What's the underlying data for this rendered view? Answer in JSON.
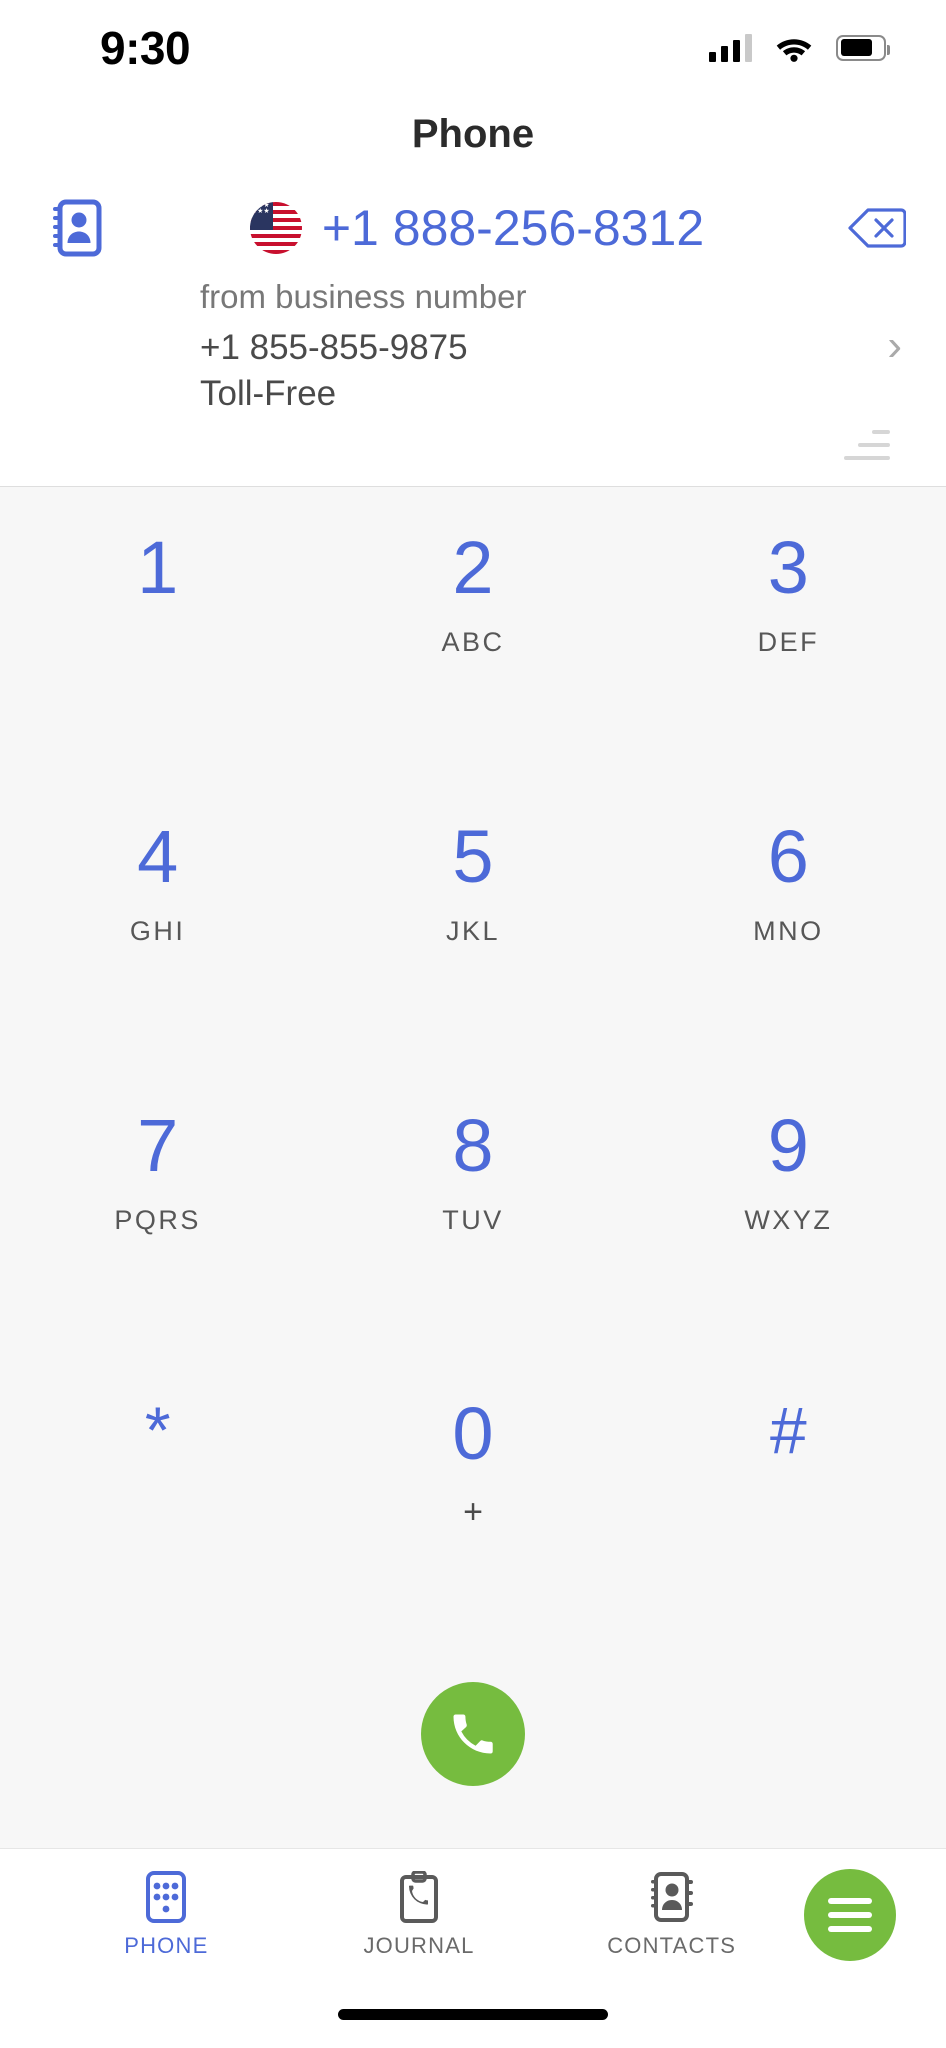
{
  "status_bar": {
    "time": "9:30",
    "signal_icon": "cellular-signal-icon",
    "wifi_icon": "wifi-icon",
    "battery_icon": "battery-icon"
  },
  "header": {
    "title": "Phone"
  },
  "dial_field": {
    "contacts_icon": "address-book-icon",
    "flag_icon": "us-flag-icon",
    "number": "+1 888-256-8312",
    "backspace_icon": "backspace-icon"
  },
  "business_number": {
    "label": "from business number",
    "number": "+1 855-855-9875",
    "type": "Toll-Free",
    "chevron_icon": "chevron-right-icon",
    "filter_icon": "sort-lines-icon"
  },
  "dialpad": {
    "keys": [
      {
        "digit": "1",
        "letters": ""
      },
      {
        "digit": "2",
        "letters": "ABC"
      },
      {
        "digit": "3",
        "letters": "DEF"
      },
      {
        "digit": "4",
        "letters": "GHI"
      },
      {
        "digit": "5",
        "letters": "JKL"
      },
      {
        "digit": "6",
        "letters": "MNO"
      },
      {
        "digit": "7",
        "letters": "PQRS"
      },
      {
        "digit": "8",
        "letters": "TUV"
      },
      {
        "digit": "9",
        "letters": "WXYZ"
      },
      {
        "digit": "*",
        "letters": ""
      },
      {
        "digit": "0",
        "letters": "+"
      },
      {
        "digit": "#",
        "letters": ""
      }
    ],
    "call_button_icon": "phone-handset-icon"
  },
  "tabbar": {
    "tabs": [
      {
        "label": "PHONE",
        "icon": "dialpad-icon",
        "active": true
      },
      {
        "label": "JOURNAL",
        "icon": "clipboard-phone-icon",
        "active": false
      },
      {
        "label": "CONTACTS",
        "icon": "address-book-icon",
        "active": false
      }
    ],
    "menu_button_icon": "hamburger-menu-icon"
  },
  "colors": {
    "accent_blue": "#4d6ad8",
    "accent_green": "#76bc3f",
    "dialpad_bg": "#f7f7f7",
    "text_gray": "#4a4a4a",
    "muted_gray": "#787878"
  }
}
